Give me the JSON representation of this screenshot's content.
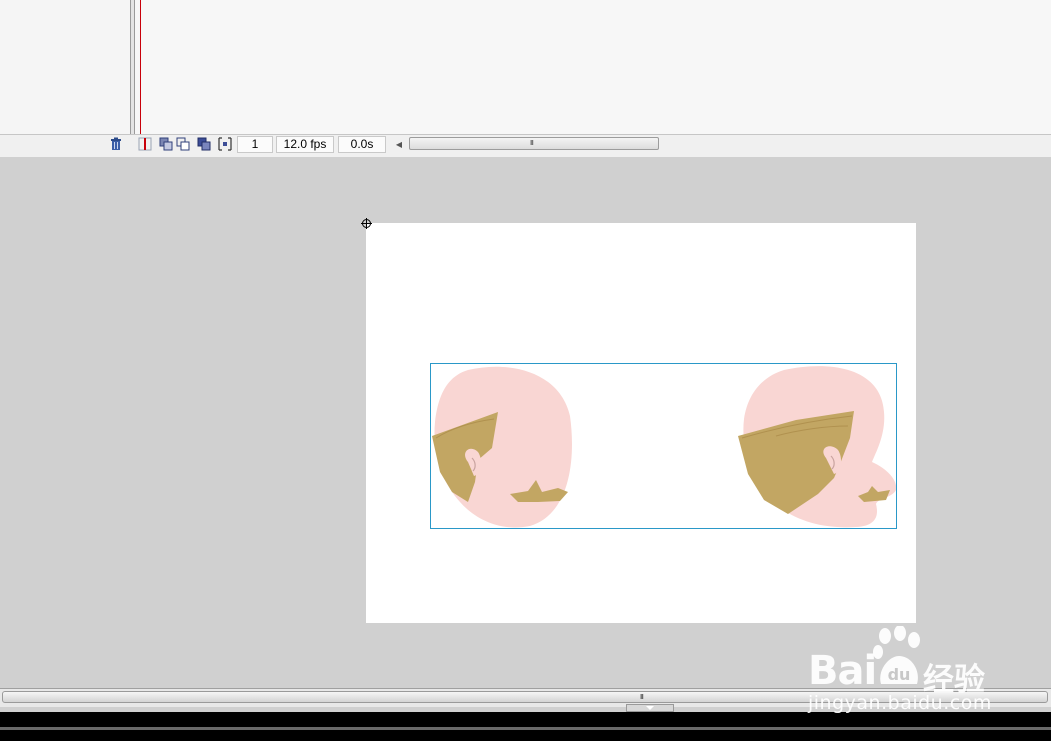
{
  "timeline": {
    "current_frame": "1",
    "frame_rate": "12.0 fps",
    "elapsed_time": "0.0s",
    "scroll_grip": "III"
  },
  "bottom_scroll": {
    "grip": "III"
  },
  "watermark": {
    "brand": "Bai",
    "brand_cn": "经验",
    "url": "jingyan.baidu.com"
  },
  "colors": {
    "stage_bg": "#ffffff",
    "pasteboard": "#d0d0d0",
    "selection": "#2a98c8",
    "skin": "#f9d6d3",
    "hair": "#c2a663",
    "playhead": "#c8000a"
  },
  "icons": [
    "trash-icon",
    "onion-skin-icon",
    "onion-skin-outline-icon",
    "edit-multiple-frames-icon",
    "modify-onion-markers-icon",
    "registration-point-icon",
    "paw-icon"
  ]
}
